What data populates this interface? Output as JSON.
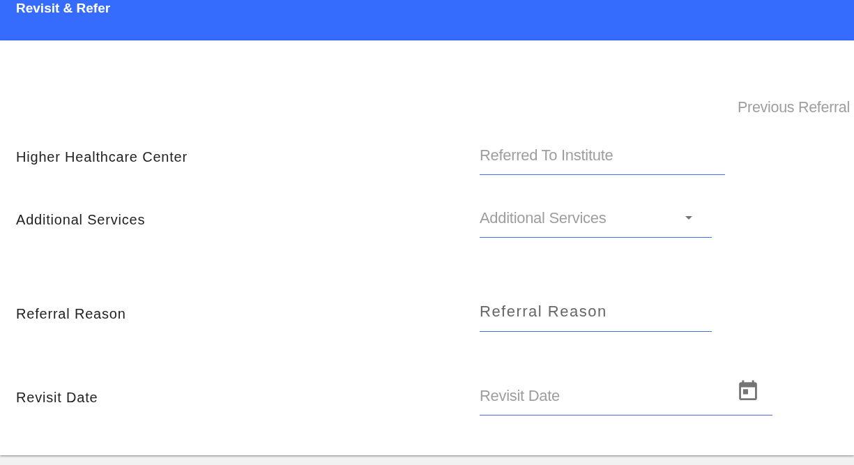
{
  "header": {
    "title": "Revisit & Refer"
  },
  "previous_referral_link": "Previous Referral",
  "form": {
    "rows": [
      {
        "label": "Higher Healthcare Center",
        "field": {
          "kind": "text",
          "placeholder": "Referred To Institute"
        }
      },
      {
        "label": "Additional Services",
        "field": {
          "kind": "select",
          "placeholder": "Additional Services"
        }
      },
      {
        "label": "Referral Reason",
        "field": {
          "kind": "textarea",
          "placeholder": "Referral Reason"
        }
      },
      {
        "label": "Revisit Date",
        "field": {
          "kind": "date",
          "placeholder": "Revisit Date"
        }
      }
    ]
  }
}
